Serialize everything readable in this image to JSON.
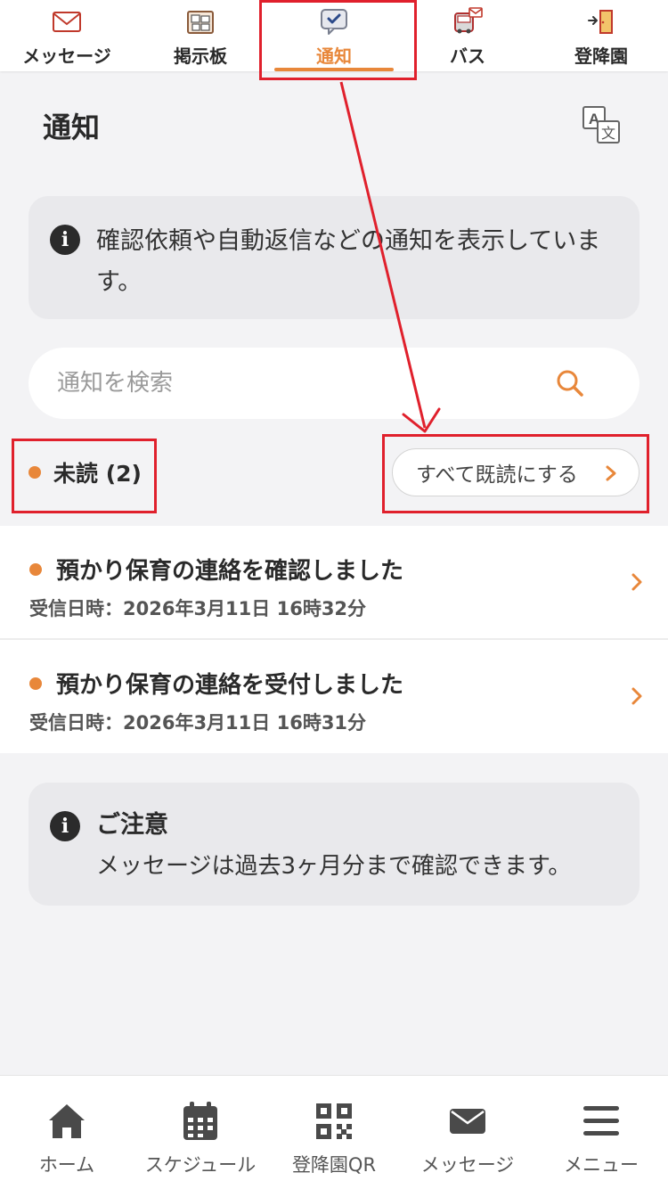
{
  "top_nav": {
    "items": [
      {
        "label": "メッセージ",
        "icon": "envelope-icon"
      },
      {
        "label": "掲示板",
        "icon": "bulletin-board-icon"
      },
      {
        "label": "通知",
        "icon": "notification-check-icon",
        "active": true
      },
      {
        "label": "バス",
        "icon": "bus-icon"
      },
      {
        "label": "登降園",
        "icon": "door-icon"
      }
    ]
  },
  "page": {
    "title": "通知",
    "translate_icon": "translate-icon"
  },
  "info_box": {
    "text": "確認依頼や自動返信などの通知を表示しています。"
  },
  "search": {
    "placeholder": "通知を検索",
    "value": ""
  },
  "unread": {
    "label": "未読 (2)",
    "mark_all_label": "すべて既読にする"
  },
  "notifications": [
    {
      "title": "預かり保育の連絡を確認しました",
      "date": "受信日時：2026年3月11日 16時32分"
    },
    {
      "title": "預かり保育の連絡を受付しました",
      "date": "受信日時：2026年3月11日 16時31分"
    }
  ],
  "notice": {
    "title": "ご注意",
    "text": "メッセージは過去3ヶ月分まで確認できます。"
  },
  "bottom_nav": {
    "items": [
      {
        "label": "ホーム",
        "icon": "home-icon"
      },
      {
        "label": "スケジュール",
        "icon": "calendar-icon"
      },
      {
        "label": "登降園QR",
        "icon": "qr-code-icon"
      },
      {
        "label": "メッセージ",
        "icon": "envelope-icon"
      },
      {
        "label": "メニュー",
        "icon": "menu-icon"
      }
    ]
  },
  "colors": {
    "accent": "#e8873a",
    "annotation": "#e0202c",
    "background": "#f3f3f5"
  }
}
